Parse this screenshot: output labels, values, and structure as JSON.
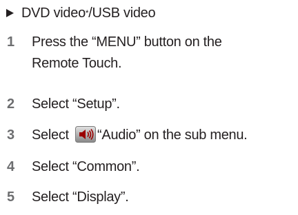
{
  "header": {
    "text_a": "DVD video",
    "mark": "*",
    "text_b": "/USB video"
  },
  "steps": [
    {
      "num": "1",
      "line1": "Press the “MENU” button on the",
      "line2": "Remote Touch."
    },
    {
      "num": "2",
      "text": "Select “Setup”."
    },
    {
      "num": "3",
      "pre": "Select ",
      "post": "“Audio” on the sub menu.",
      "icon": "speaker-icon"
    },
    {
      "num": "4",
      "text": "Select “Common”."
    },
    {
      "num": "5",
      "text": "Select “Display”."
    }
  ],
  "colors": {
    "text": "#231f20",
    "step_number": "#6d6e70",
    "icon_bg_top": "#d8d8d8",
    "icon_bg_bottom": "#8c8c8c",
    "icon_speaker": "#9b0000"
  }
}
